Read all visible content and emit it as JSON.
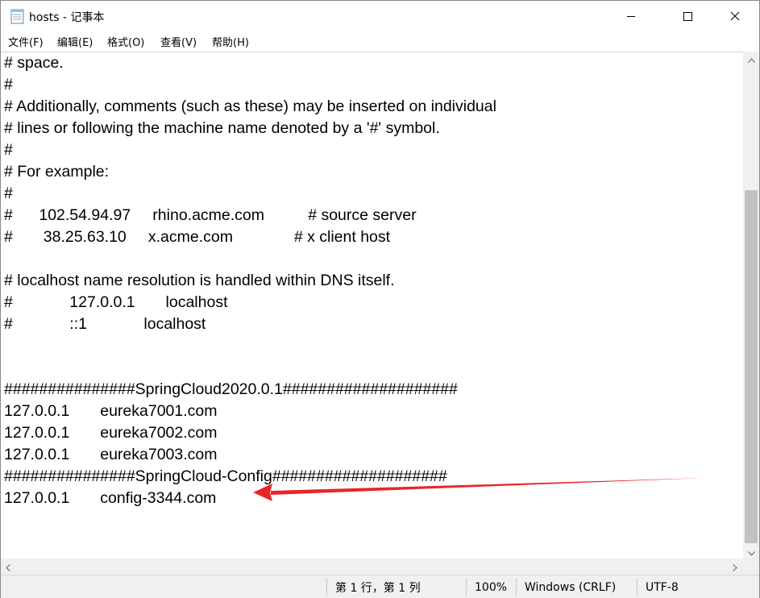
{
  "window": {
    "title": "hosts - 记事本"
  },
  "menu": [
    {
      "label": "文件(F)"
    },
    {
      "label": "编辑(E)"
    },
    {
      "label": "格式(O)"
    },
    {
      "label": "查看(V)"
    },
    {
      "label": "帮助(H)"
    }
  ],
  "editor": {
    "lines": [
      "# space.",
      "#",
      "# Additionally, comments (such as these) may be inserted on individual",
      "# lines or following the machine name denoted by a '#' symbol.",
      "#",
      "# For example:",
      "#",
      "#      102.54.94.97     rhino.acme.com          # source server",
      "#       38.25.63.10     x.acme.com              # x client host",
      "",
      "# localhost name resolution is handled within DNS itself.",
      "#             127.0.0.1       localhost",
      "#             ::1             localhost",
      "",
      "",
      "###############SpringCloud2020.0.1####################",
      "127.0.0.1       eureka7001.com",
      "127.0.0.1       eureka7002.com",
      "127.0.0.1       eureka7003.com",
      "###############SpringCloud-Config####################",
      "127.0.0.1       config-3344.com"
    ]
  },
  "status": {
    "position": "第 1 行，第 1 列",
    "zoom": "100%",
    "line_ending": "Windows (CRLF)",
    "encoding": "UTF-8"
  },
  "icons": {
    "app": "notepad-icon",
    "minimize": "minimize-icon",
    "maximize": "maximize-icon",
    "close": "close-icon"
  },
  "colors": {
    "annotation_arrow": "#e8262a",
    "scroll_thumb": "#c1c1c1",
    "statusbar_bg": "#f0f0f0"
  }
}
